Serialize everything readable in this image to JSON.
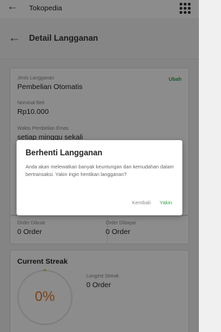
{
  "app_bar": {
    "back_icon": "arrow-left-icon",
    "title": "Tokopedia",
    "menu_icon": "grid-menu-icon"
  },
  "page_header": {
    "back_icon": "arrow-left-icon",
    "title": "Detail Langganan"
  },
  "subscription": {
    "type_label": "Jenis Langganan",
    "type_value": "Pembelian Otomatis",
    "edit_label": "Ubah",
    "amount_label": "Nominal Beli",
    "amount_value": "Rp10.000",
    "schedule_label": "Waktu Pembelian Emas",
    "schedule_value": "setiap minggu sekali"
  },
  "orders": {
    "created_label": "Order Dibuat",
    "created_value": "0 Order",
    "paid_label": "Order Dibayar",
    "paid_value": "0 Order"
  },
  "streak": {
    "title": "Current Streak",
    "percent": "0%",
    "percent_value": 0,
    "longest_label": "Longest Streak",
    "longest_value": "0 Order"
  },
  "dialog": {
    "title": "Berhenti Langganan",
    "message": "Anda akan melewatkan banyak keuntungan dan kemudahan dalam bertransaksi. Yakin ingin hentikan langganan?",
    "cancel_label": "Kembali",
    "confirm_label": "Yakin"
  },
  "colors": {
    "accent_green": "#38a34a",
    "percent_orange": "#e07b2a"
  }
}
